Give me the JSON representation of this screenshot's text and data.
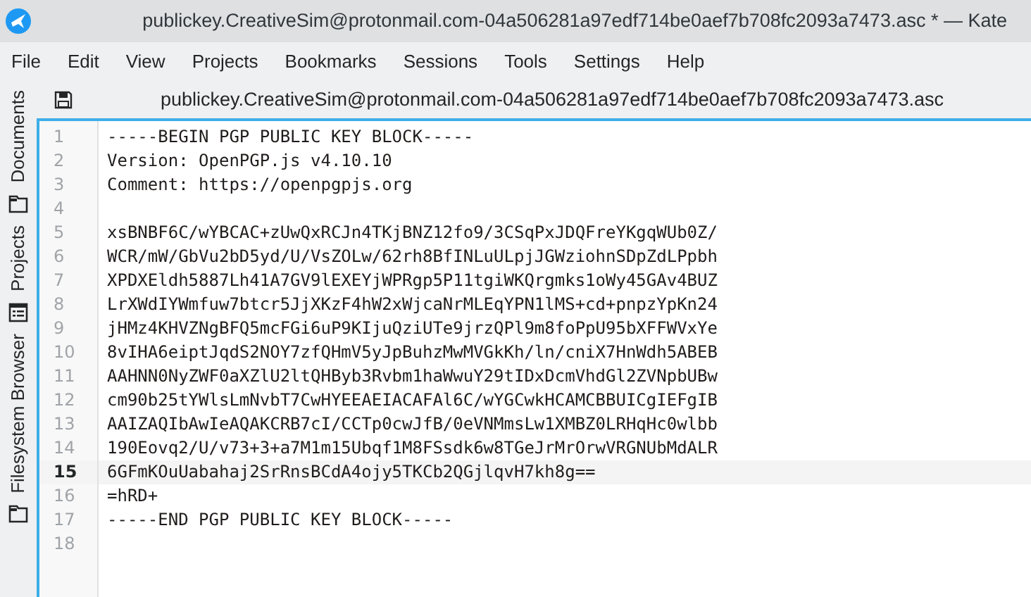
{
  "window": {
    "title": "publickey.CreativeSim@protonmail.com-04a506281a97edf714be0aef7b708fc2093a7473.asc * — Kate"
  },
  "menu": [
    "File",
    "Edit",
    "View",
    "Projects",
    "Bookmarks",
    "Sessions",
    "Tools",
    "Settings",
    "Help"
  ],
  "sidebar": {
    "items": [
      {
        "label": "Documents"
      },
      {
        "label": "Projects"
      },
      {
        "label": "Filesystem Browser"
      }
    ]
  },
  "tab": {
    "label": "publickey.CreativeSim@protonmail.com-04a506281a97edf714be0aef7b708fc2093a7473.asc"
  },
  "editor": {
    "lines": [
      {
        "number": "1",
        "text": "-----BEGIN PGP PUBLIC KEY BLOCK-----",
        "current": false
      },
      {
        "number": "2",
        "text": "Version: OpenPGP.js v4.10.10",
        "current": false
      },
      {
        "number": "3",
        "text": "Comment: https://openpgpjs.org",
        "current": false
      },
      {
        "number": "4",
        "current": false
      },
      {
        "number": "5",
        "text": "xsBNBF6C/wYBCAC+zUwQxRCJn4TKjBNZ12fo9/3CSqPxJDQFreYKgqWUb0Z/",
        "current": false
      },
      {
        "number": "6",
        "text": "WCR/mW/GbVu2bD5yd/U/VsZOLw/62rh8BfINLuULpjJGWziohnSDpZdLPpbh",
        "current": false
      },
      {
        "number": "7",
        "text": "XPDXEldh5887Lh41A7GV9lEXEYjWPRgp5P11tgiWKQrgmks1oWy45GAv4BUZ",
        "current": false
      },
      {
        "number": "8",
        "text": "LrXWdIYWmfuw7btcr5JjXKzF4hW2xWjcaNrMLEqYPN1lMS+cd+pnpzYpKn24",
        "current": false
      },
      {
        "number": "9",
        "text": "jHMz4KHVZNgBFQ5mcFGi6uP9KIjuQziUTe9jrzQPl9m8foPpU95bXFFWVxYe",
        "current": false
      },
      {
        "number": "10",
        "text": "8vIHA6eiptJqdS2NOY7zfQHmV5yJpBuhzMwMVGkKh/ln/cniX7HnWdh5ABEB",
        "current": false
      },
      {
        "number": "11",
        "text": "AAHNN0NyZWF0aXZlU2ltQHByb3Rvbm1haWwuY29tIDxDcmVhdGl2ZVNpbUBw",
        "current": false
      },
      {
        "number": "12",
        "text": "cm90b25tYWlsLmNvbT7CwHYEEAEIACAFAl6C/wYGCwkHCAMCBBUICgIEFgIB",
        "current": false
      },
      {
        "number": "13",
        "text": "AAIZAQIbAwIeAQAKCRB7cI/CCTp0cwJfB/0eVNMmsLw1XMBZ0LRHqHc0wlbb",
        "current": false
      },
      {
        "number": "14",
        "text": "190Eovq2/U/v73+3+a7M1m15Ubqf1M8FSsdk6w8TGeJrMrOrwVRGNUbMdALR",
        "current": false
      },
      {
        "number": "15",
        "text": "6GFmKOuUabahaj2SrRnsBCdA4ojy5TKCb2QGjlqvH7kh8g==",
        "current": true
      },
      {
        "number": "16",
        "text": "=hRD+",
        "current": false
      },
      {
        "number": "17",
        "text": "-----END PGP PUBLIC KEY BLOCK-----",
        "current": false
      },
      {
        "number": "18",
        "current": false
      }
    ]
  }
}
